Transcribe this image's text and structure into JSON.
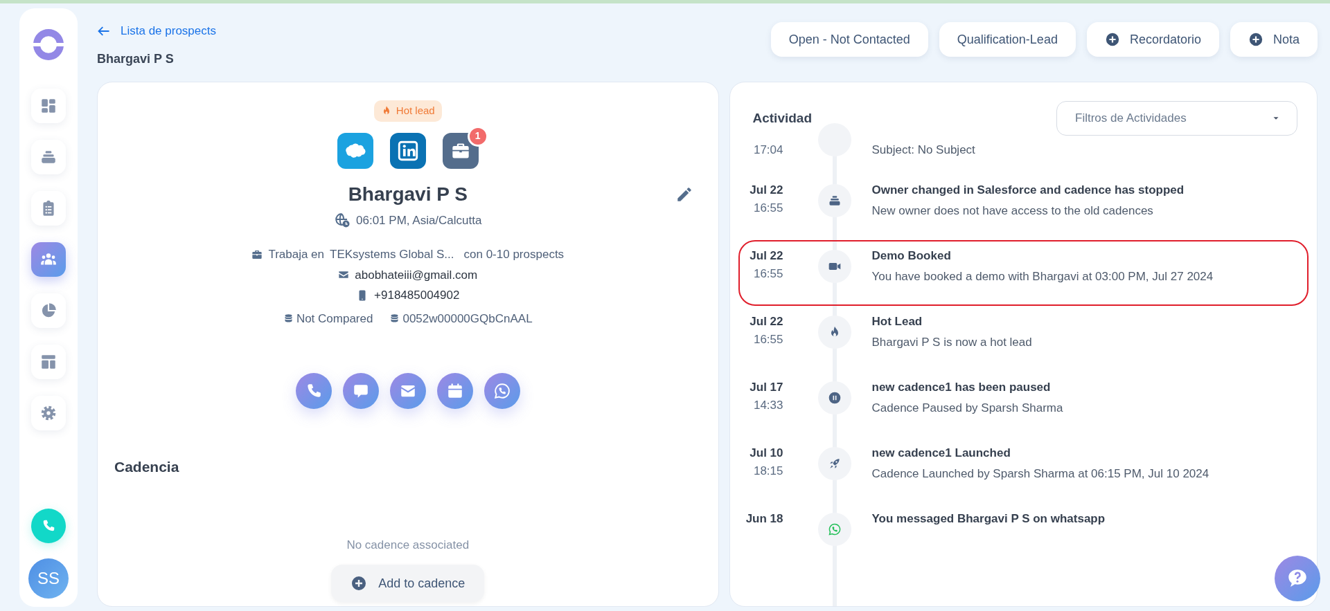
{
  "sidebar": {
    "items": [
      {
        "kind": "dashboard",
        "selected": false
      },
      {
        "kind": "stack",
        "selected": false
      },
      {
        "kind": "clipboard",
        "selected": false
      },
      {
        "kind": "people",
        "selected": true
      },
      {
        "kind": "pie",
        "selected": false
      },
      {
        "kind": "layout",
        "selected": false
      },
      {
        "kind": "settings",
        "selected": false
      }
    ],
    "avatar": {
      "initials": "SS"
    }
  },
  "breadcrumb": {
    "back_link": "Lista de prospects",
    "title": "Bhargavi P S"
  },
  "header_buttons": [
    {
      "label": "Open - Not Contacted",
      "kind": "plain"
    },
    {
      "label": "Qualification-Lead",
      "kind": "plain"
    },
    {
      "label": "Recordatorio",
      "kind": "add"
    },
    {
      "label": "Nota",
      "kind": "add"
    }
  ],
  "profile": {
    "badge": "Hot lead",
    "links": [
      {
        "kind": "salesforce"
      },
      {
        "kind": "linkedin"
      },
      {
        "kind": "company",
        "count": "1"
      }
    ],
    "name": "Bhargavi P S",
    "timezone": "06:01 PM, Asia/Calcutta",
    "works_at": "Trabaja en",
    "company": "TEKsystems Global S...",
    "prospects": "con 0-10 prospects",
    "email": "abobhateiii@gmail.com",
    "phone": "+918485004902",
    "crm_status": "Not Compared",
    "crm_id": "0052w00000GQbCnAAL",
    "actions": [
      {
        "kind": "call"
      },
      {
        "kind": "chat"
      },
      {
        "kind": "email"
      },
      {
        "kind": "calendar"
      },
      {
        "kind": "whatsapp"
      }
    ]
  },
  "cadence": {
    "title": "Cadencia",
    "empty_text": "No cadence associated",
    "add_button": "Add to cadence"
  },
  "activity": {
    "title": "Actividad",
    "filter": {
      "placeholder": "Filtros de Actividades"
    },
    "items": [
      {
        "kind": "blank",
        "time": "17:04",
        "text": "Subject: No Subject",
        "highlighted": false
      },
      {
        "kind": "stack",
        "date": "Jul 22",
        "time": "16:55",
        "title": "Owner changed in Salesforce and cadence has stopped",
        "text": "New owner does not have access to the old cadences",
        "highlighted": false
      },
      {
        "kind": "video",
        "date": "Jul 22",
        "time": "16:55",
        "title": "Demo Booked",
        "text": "You have booked a demo with Bhargavi at 03:00 PM, Jul 27 2024",
        "highlighted": true
      },
      {
        "kind": "flame",
        "date": "Jul 22",
        "time": "16:55",
        "title": "Hot Lead",
        "text": "Bhargavi P S is now a hot lead",
        "highlighted": false
      },
      {
        "kind": "pause",
        "date": "Jul 17",
        "time": "14:33",
        "title": "new cadence1 has been paused",
        "text": "Cadence Paused by Sparsh Sharma",
        "highlighted": false
      },
      {
        "kind": "rocket",
        "date": "Jul 10",
        "time": "18:15",
        "title": "new cadence1 Launched",
        "text": "Cadence Launched by Sparsh Sharma at 06:15 PM, Jul 10 2024",
        "highlighted": false
      },
      {
        "kind": "whatsapp",
        "date": "Jun 18",
        "title": "You messaged Bhargavi P S on whatsapp",
        "highlighted": false
      }
    ]
  }
}
